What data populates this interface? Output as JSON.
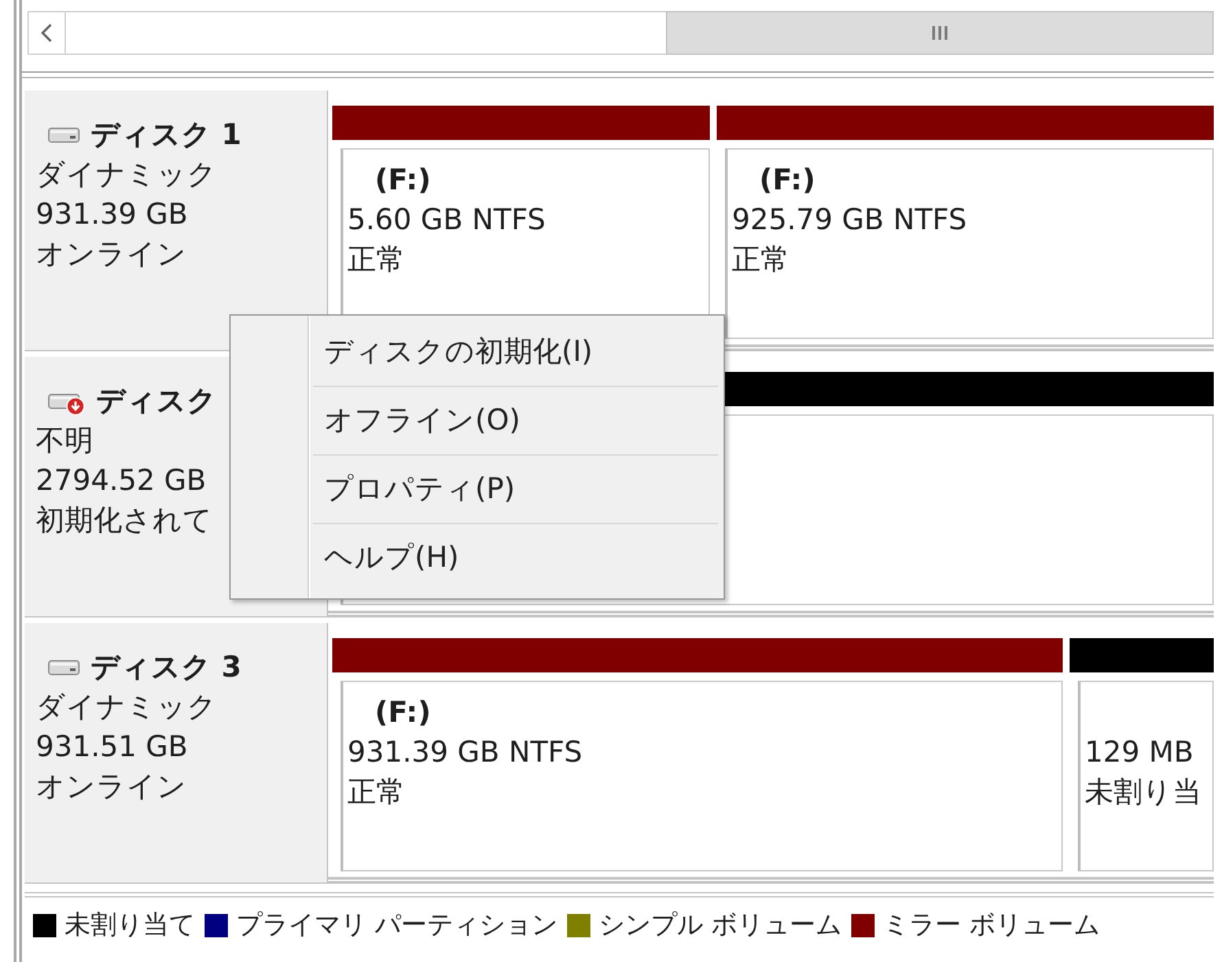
{
  "disks": [
    {
      "name": "ディスク 1",
      "alert": false,
      "type": "ダイナミック",
      "size": "931.39 GB",
      "status": "オンライン",
      "partitions": [
        {
          "color": "#800000",
          "label": "(F:)",
          "size": "5.60 GB NTFS",
          "status": "正常"
        },
        {
          "color": "#800000",
          "label": "(F:)",
          "size": "925.79 GB NTFS",
          "status": "正常"
        }
      ]
    },
    {
      "name": "ディスク",
      "alert": true,
      "type": "不明",
      "size": "2794.52 GB",
      "status": "初期化されて",
      "partitions": [
        {
          "color": "#000000"
        }
      ]
    },
    {
      "name": "ディスク 3",
      "alert": false,
      "type": "ダイナミック",
      "size": "931.51 GB",
      "status": "オンライン",
      "partitions": [
        {
          "color": "#800000",
          "label": "(F:)",
          "size": "931.39 GB NTFS",
          "status": "正常"
        },
        {
          "color": "#000000",
          "size": "129 MB",
          "status": "未割り当"
        }
      ]
    }
  ],
  "context_menu": {
    "items": [
      {
        "label": "ディスクの初期化(I)"
      },
      {
        "label": "オフライン(O)"
      },
      {
        "label": "プロパティ(P)"
      },
      {
        "label": "ヘルプ(H)"
      }
    ]
  },
  "legend": [
    {
      "color": "#000000",
      "label": "未割り当て"
    },
    {
      "color": "#000080",
      "label": "プライマリ パーティション"
    },
    {
      "color": "#808000",
      "label": "シンプル ボリューム"
    },
    {
      "color": "#800000",
      "label": "ミラー ボリューム"
    }
  ]
}
